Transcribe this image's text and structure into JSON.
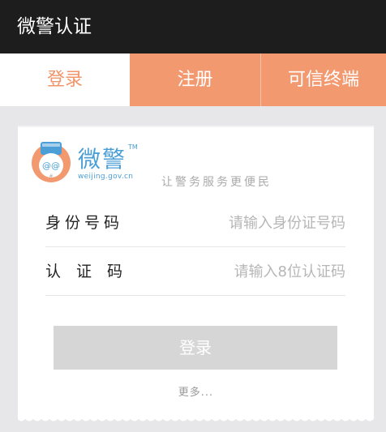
{
  "titlebar": {
    "title": "微警认证"
  },
  "tabs": [
    {
      "label": "登录",
      "active": true
    },
    {
      "label": "注册",
      "active": false
    },
    {
      "label": "可信终端",
      "active": false
    }
  ],
  "brand": {
    "name": "微警",
    "trademark": "TM",
    "url": "weijing.gov.cn",
    "slogan": "让警务服务更便民",
    "logo_icon": "police-mascot-icon",
    "logo_symbols": "@@",
    "colors": {
      "blue": "#4b9fd6",
      "orange": "#f2996f"
    }
  },
  "form": {
    "id_label": "身份号码",
    "id_placeholder": "请输入身份证号码",
    "id_value": "",
    "code_label": "认证码",
    "code_placeholder": "请输入8位认证码",
    "code_value": "",
    "login_label": "登录",
    "more_label": "更多..."
  },
  "colors": {
    "titlebar_bg": "#1d1d1d",
    "accent": "#f2996f",
    "active_tab_text": "#f0956a",
    "button_disabled": "#d6d6d6",
    "page_bg": "#e7e7ea"
  }
}
